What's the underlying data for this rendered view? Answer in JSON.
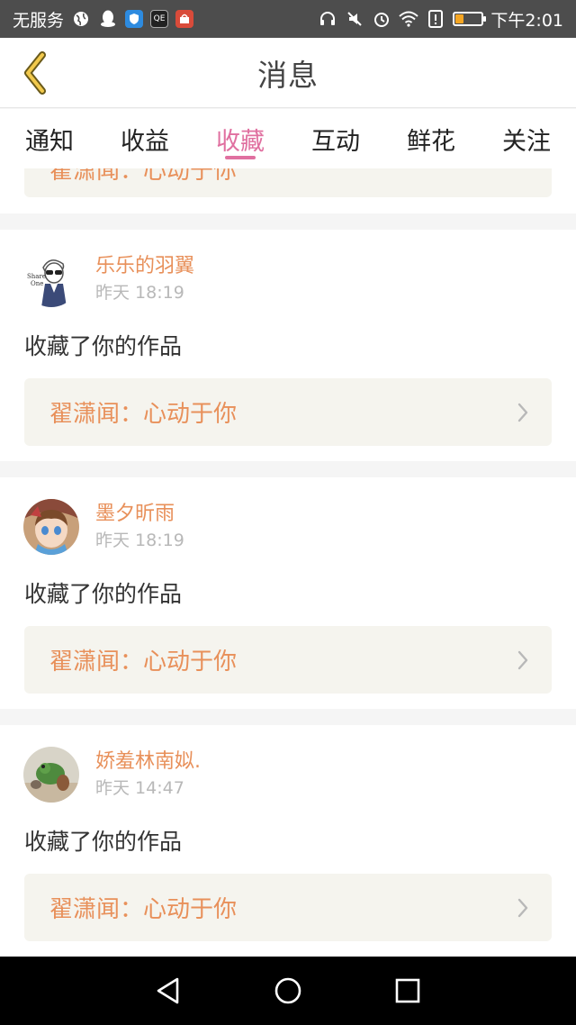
{
  "status_bar": {
    "carrier": "无服务",
    "time": "下午2:01",
    "icons": [
      "globe-icon",
      "qq-icon",
      "shield-app-icon",
      "mall-app-icon",
      "shop-app-icon",
      "headphones-icon",
      "mute-icon",
      "alarm-icon",
      "wifi-icon",
      "alert-icon",
      "battery-icon"
    ]
  },
  "header": {
    "title": "消息",
    "back_icon": "chevron-left-icon"
  },
  "tabs": [
    {
      "label": "通知"
    },
    {
      "label": "收益"
    },
    {
      "label": "收藏"
    },
    {
      "label": "互动"
    },
    {
      "label": "鲜花"
    },
    {
      "label": "关注"
    }
  ],
  "active_tab": "收藏",
  "partial_item": {
    "work_title": "翟潇闻：心动于你"
  },
  "items": [
    {
      "username": "乐乐的羽翼",
      "time": "昨天 18:19",
      "action": "收藏了你的作品",
      "work_title": "翟潇闻：心动于你"
    },
    {
      "username": "墨夕昕雨",
      "time": "昨天 18:19",
      "action": "收藏了你的作品",
      "work_title": "翟潇闻：心动于你"
    },
    {
      "username": "娇羞林南姒.",
      "time": "昨天 14:47",
      "action": "收藏了你的作品",
      "work_title": "翟潇闻：心动于你"
    }
  ],
  "colors": {
    "accent": "#e070a0",
    "username": "#e8905a",
    "card_bg": "#f5f4ee"
  }
}
